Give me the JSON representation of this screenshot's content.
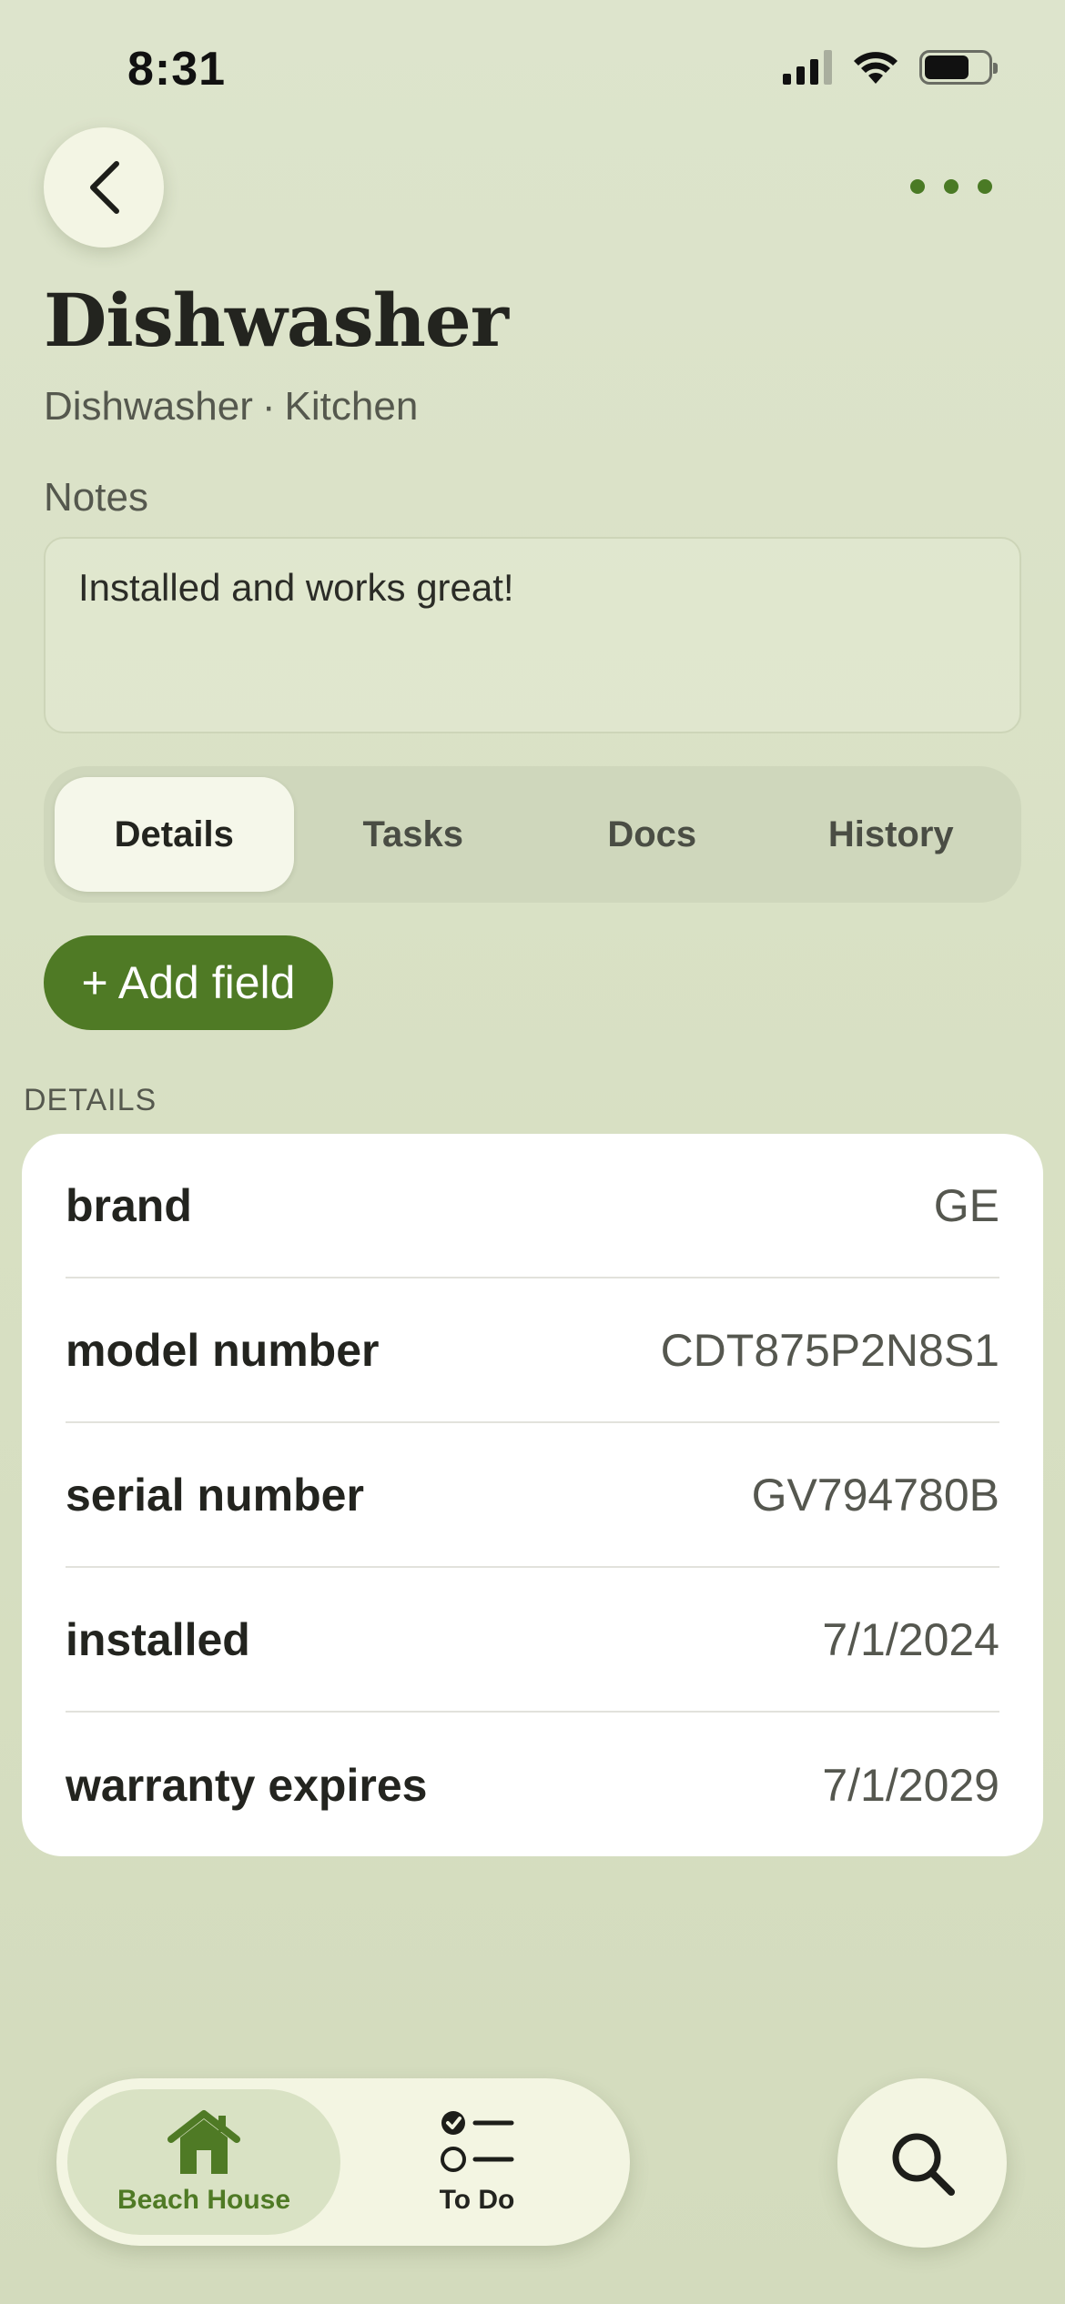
{
  "status_bar": {
    "time": "8:31"
  },
  "header": {
    "title": "Dishwasher",
    "subtitle_type": "Dishwasher",
    "subtitle_separator": "·",
    "subtitle_room": "Kitchen"
  },
  "notes": {
    "label": "Notes",
    "value": "Installed and works great!"
  },
  "tabs": [
    {
      "label": "Details",
      "active": true
    },
    {
      "label": "Tasks",
      "active": false
    },
    {
      "label": "Docs",
      "active": false
    },
    {
      "label": "History",
      "active": false
    }
  ],
  "add_field_label": "+ Add field",
  "details": {
    "section_label": "DETAILS",
    "rows": [
      {
        "key": "brand",
        "value": "GE"
      },
      {
        "key": "model number",
        "value": "CDT875P2N8S1"
      },
      {
        "key": "serial number",
        "value": "GV794780B"
      },
      {
        "key": "installed",
        "value": "7/1/2024"
      },
      {
        "key": "warranty expires",
        "value": "7/1/2029"
      }
    ]
  },
  "bottom_nav": {
    "items": [
      {
        "label": "Beach House",
        "icon": "house-icon",
        "active": true
      },
      {
        "label": "To Do",
        "icon": "checklist-icon",
        "active": false
      }
    ],
    "search_icon": "search-icon"
  },
  "colors": {
    "accent": "#4f7a25",
    "background": "#dde4cc",
    "card": "#ffffff"
  }
}
